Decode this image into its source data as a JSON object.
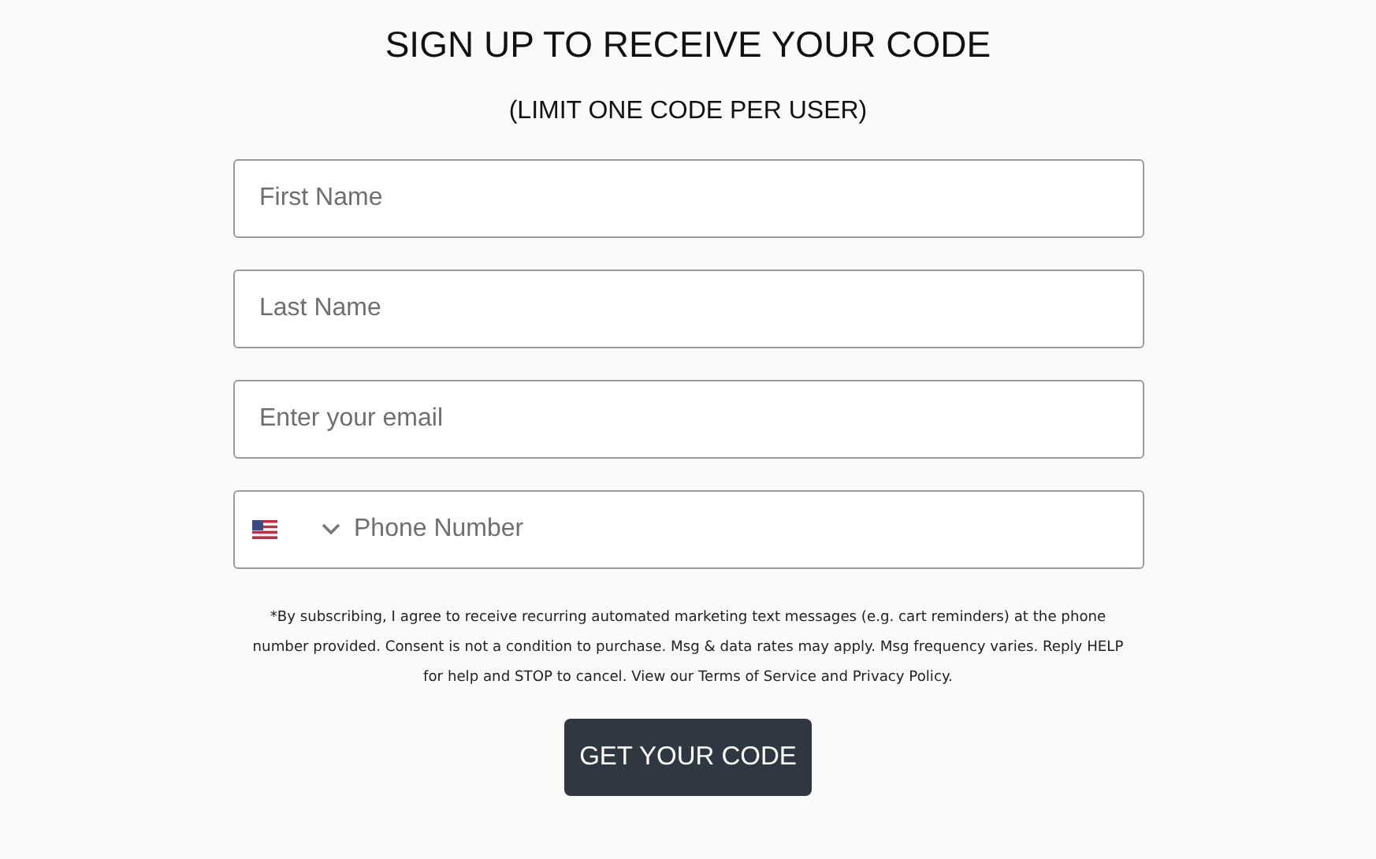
{
  "title": "SIGN UP TO RECEIVE YOUR CODE",
  "subtitle": "(LIMIT ONE CODE PER USER)",
  "fields": [
    {
      "kind": "text",
      "placeholder": "First Name"
    },
    {
      "kind": "text",
      "placeholder": "Last Name"
    },
    {
      "kind": "text",
      "placeholder": "Enter your email"
    },
    {
      "kind": "phone",
      "placeholder": "Phone Number"
    }
  ],
  "disclaimer": "*By subscribing, I agree to receive recurring automated marketing text messages (e.g. cart reminders) at the phone number provided. Consent is not a condition to purchase. Msg & data rates may apply. Msg frequency varies. Reply HELP for help and STOP to cancel. View our Terms of Service and Privacy Policy.",
  "button": "GET YOUR CODE"
}
